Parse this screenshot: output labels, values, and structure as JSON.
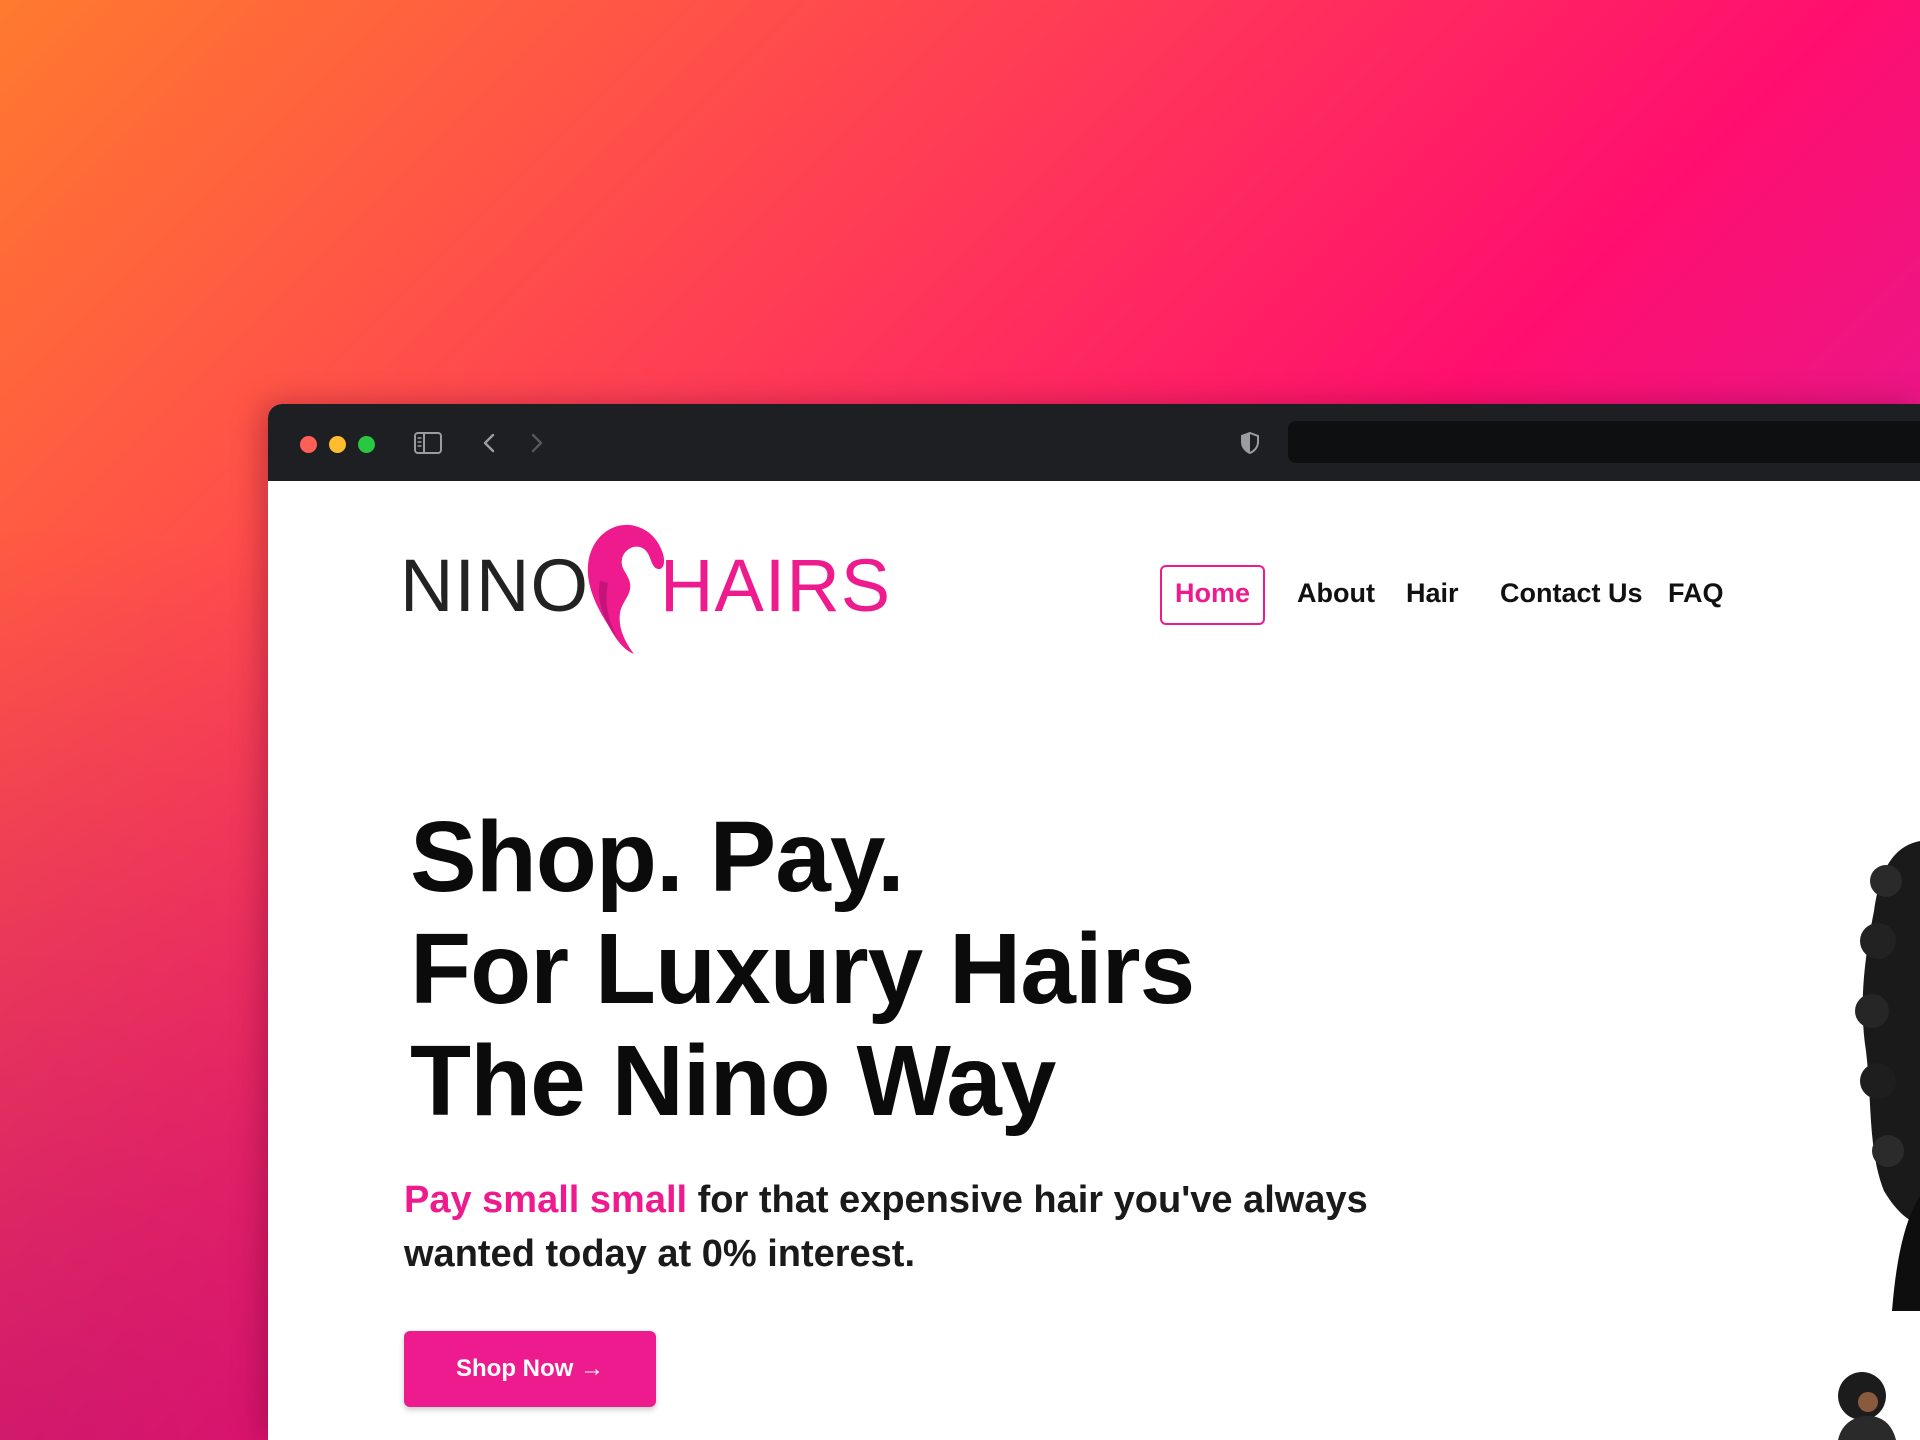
{
  "brand": {
    "name_left": "NINO",
    "name_right": "HAIRS",
    "accent_color": "#ee1b8f",
    "logo_icon": "hair-silhouette-icon"
  },
  "browser": {
    "icons": [
      "sidebar-icon",
      "chevron-left-icon",
      "chevron-right-icon",
      "shield-icon",
      "reload-icon"
    ],
    "address_value": ""
  },
  "nav": {
    "items": [
      {
        "label": "Home",
        "active": true
      },
      {
        "label": "About"
      },
      {
        "label": "Hair"
      },
      {
        "label": "Contact Us"
      },
      {
        "label": "FAQ"
      }
    ]
  },
  "hero": {
    "title_lines": [
      "Shop. Pay.",
      "For Luxury Hairs",
      "The Nino Way"
    ],
    "subtitle_accent": "Pay small small",
    "subtitle_rest_1": " for that expensive hair you've always",
    "subtitle_rest_2": "wanted today at 0% interest.",
    "cta_label": "Shop Now →"
  }
}
